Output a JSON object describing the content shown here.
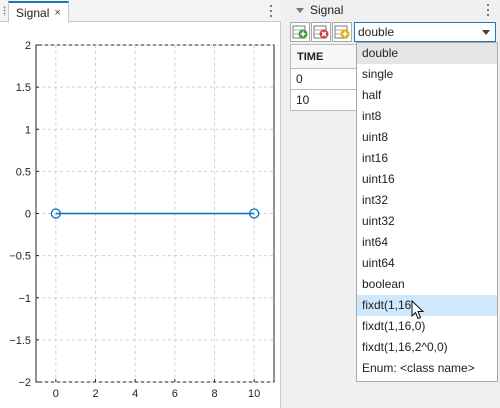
{
  "plot_panel": {
    "tab_label": "Signal",
    "close_glyph": "×",
    "icons": [
      "grip-icon",
      "close-icon",
      "more-options-icon"
    ]
  },
  "chart_data": {
    "type": "line",
    "title": "",
    "xlabel": "",
    "ylabel": "",
    "x_ticks": [
      "0",
      "2",
      "4",
      "6",
      "8",
      "10"
    ],
    "y_ticks": [
      "2",
      "1.5",
      "1",
      "0.5",
      "0",
      "−0.5",
      "−1",
      "−1.5",
      "−2"
    ],
    "xlim": [
      -1,
      11
    ],
    "ylim": [
      -2,
      2
    ],
    "grid": true,
    "series": [
      {
        "x": [
          0,
          10
        ],
        "y": [
          0,
          0
        ],
        "color": "#0072bd",
        "marker": "circle"
      }
    ]
  },
  "signal_panel": {
    "title": "Signal",
    "toolbar": {
      "add_icon": "add-row-icon",
      "delete_icon": "delete-row-icon",
      "insert_icon": "insert-row-icon"
    },
    "data_type_value": "double",
    "table": {
      "header": "TIME",
      "rows": [
        "0",
        "10"
      ]
    }
  },
  "data_type_options": [
    "double",
    "single",
    "half",
    "int8",
    "uint8",
    "int16",
    "uint16",
    "int32",
    "uint32",
    "int64",
    "uint64",
    "boolean",
    "fixdt(1,16)",
    "fixdt(1,16,0)",
    "fixdt(1,16,2^0,0)",
    "Enum: <class name>"
  ],
  "dropdown_state": {
    "selected_index": 0,
    "hover_index": 12
  },
  "colors": {
    "accent": "#1f77b4",
    "series": "#0072bd",
    "hover_row": "#cfe8fc",
    "selected_row": "#e6e6e6",
    "add_green": "#3a9a3a",
    "delete_red": "#d23c3c",
    "insert_yellow": "#e0b000"
  }
}
